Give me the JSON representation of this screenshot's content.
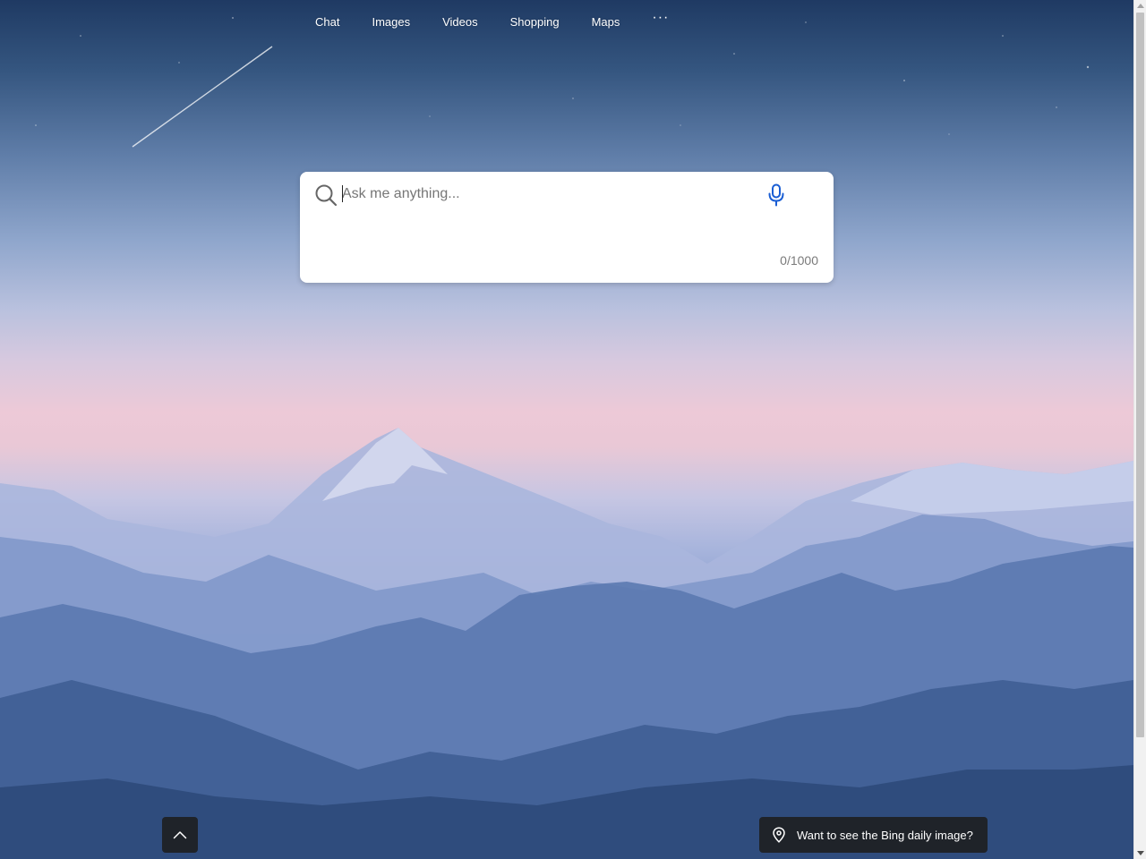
{
  "nav": {
    "items": [
      {
        "label": "Chat"
      },
      {
        "label": "Images"
      },
      {
        "label": "Videos"
      },
      {
        "label": "Shopping"
      },
      {
        "label": "Maps"
      }
    ],
    "more_label": "···"
  },
  "search": {
    "placeholder": "Ask me anything...",
    "value": "",
    "char_count": "0/1000",
    "search_icon": "search-icon",
    "mic_icon": "microphone-icon"
  },
  "footer": {
    "scroll_top_icon": "chevron-up-icon",
    "daily_image_label": "Want to see the Bing daily image?",
    "daily_image_icon": "location-pin-icon"
  },
  "background": {
    "description_icon": "mountain-landscape-image"
  },
  "colors": {
    "mic_blue": "#1a5ed4",
    "dark_button": "#1f2329"
  }
}
